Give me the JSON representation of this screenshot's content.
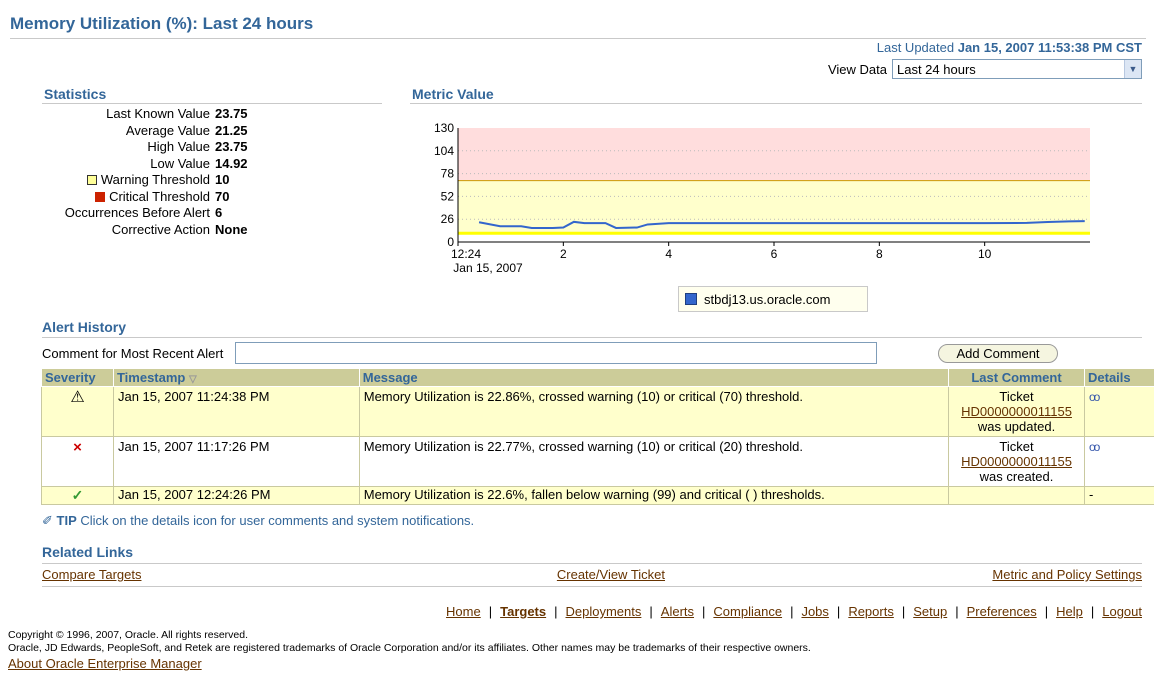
{
  "page": {
    "title": "Memory Utilization (%): Last 24 hours"
  },
  "header": {
    "last_updated_label": "Last Updated",
    "last_updated_value": "Jan 15, 2007 11:53:38 PM CST",
    "view_data_label": "View Data",
    "view_data_selected": "Last 24 hours"
  },
  "statistics": {
    "title": "Statistics",
    "rows": [
      {
        "label": "Last Known Value",
        "value": "23.75"
      },
      {
        "label": "Average Value",
        "value": "21.25"
      },
      {
        "label": "High Value",
        "value": "23.75"
      },
      {
        "label": "Low Value",
        "value": "14.92"
      },
      {
        "label": "Warning Threshold",
        "value": "10"
      },
      {
        "label": "Critical Threshold",
        "value": "70"
      },
      {
        "label": "Occurrences Before Alert",
        "value": "6"
      },
      {
        "label": "Corrective Action",
        "value": "None"
      }
    ],
    "warning_color": "#ffff99",
    "critical_color": "#cc2200"
  },
  "metric": {
    "title": "Metric Value",
    "legend_label": "stbdj13.us.oracle.com"
  },
  "chart_data": {
    "type": "line",
    "title": "Metric Value",
    "x_tick_labels": [
      "12:24",
      "2",
      "4",
      "6",
      "8",
      "10"
    ],
    "x_sublabel": "Jan 15, 2007",
    "y_tick_labels": [
      "0",
      "26",
      "52",
      "78",
      "104",
      "130"
    ],
    "ylim": [
      0,
      130
    ],
    "warning_threshold": 10,
    "critical_threshold": 70,
    "warning_band_color": "#ffffcc",
    "critical_band_color": "#ffdddd",
    "series": [
      {
        "name": "stbdj13.us.oracle.com",
        "color": "#3366cc",
        "x": [
          0.4,
          0.8,
          1.2,
          1.4,
          1.8,
          2.0,
          2.2,
          2.4,
          2.8,
          3.0,
          3.4,
          3.6,
          4.0,
          5.0,
          6.0,
          7.0,
          8.0,
          9.0,
          10.0,
          10.8,
          11.2,
          11.6,
          11.9
        ],
        "values": [
          22.5,
          18,
          18,
          16,
          16,
          16.5,
          23,
          21.5,
          21.5,
          16,
          16.5,
          20,
          21.5,
          21.5,
          21.5,
          21.5,
          21.5,
          21.5,
          21.5,
          21.8,
          22.8,
          23.5,
          23.75
        ]
      }
    ]
  },
  "alert_history": {
    "title": "Alert History",
    "comment_label": "Comment for Most Recent Alert",
    "add_comment_label": "Add Comment",
    "columns": [
      "Severity",
      "Timestamp",
      "Message",
      "Last Comment",
      "Details"
    ],
    "rows": [
      {
        "severity_icon": "warning-icon",
        "timestamp": "Jan 15, 2007 11:24:38 PM",
        "message": "Memory Utilization is 22.86%, crossed warning (10) or critical (70) threshold.",
        "comment_prefix": "Ticket",
        "comment_link": "HD0000000011155",
        "comment_suffix": "was updated."
      },
      {
        "severity_icon": "critical-icon",
        "timestamp": "Jan 15, 2007 11:17:26 PM",
        "message": "Memory Utilization is 22.77%, crossed warning (10) or critical (20) threshold.",
        "comment_prefix": "Ticket",
        "comment_link": "HD0000000011155",
        "comment_suffix": "was created."
      },
      {
        "severity_icon": "clear-icon",
        "timestamp": "Jan 15, 2007 12:24:26 PM",
        "message": "Memory Utilization is 22.6%, fallen below warning (99) and critical ( ) thresholds.",
        "details": "-"
      }
    ],
    "tip_label": "TIP",
    "tip_text": "Click on the details icon for user comments and system notifications."
  },
  "related_links": {
    "title": "Related Links",
    "compare_targets": "Compare Targets",
    "create_ticket": "Create/View Ticket",
    "metric_policy": "Metric and Policy Settings"
  },
  "footer": {
    "nav": [
      "Home",
      "Targets",
      "Deployments",
      "Alerts",
      "Compliance",
      "Jobs",
      "Reports",
      "Setup",
      "Preferences",
      "Help",
      "Logout"
    ],
    "copyright_line1": "Copyright © 1996, 2007, Oracle. All rights reserved.",
    "copyright_line2": "Oracle, JD Edwards, PeopleSoft, and Retek are registered trademarks of Oracle Corporation and/or its affiliates. Other names may be trademarks of their respective owners.",
    "about_link": "About Oracle Enterprise Manager"
  }
}
